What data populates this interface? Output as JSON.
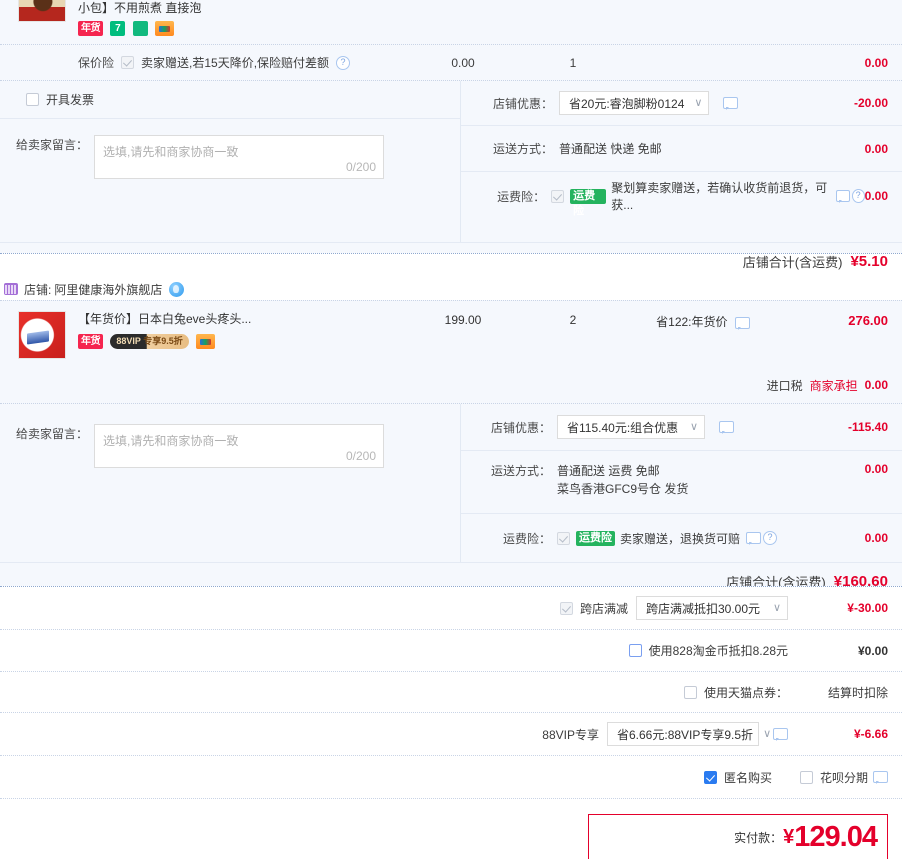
{
  "stores": [
    {
      "id": "store-1",
      "item": {
        "title_tail": "小包】不用煎煮 直接泡",
        "tags": [
          "年货",
          "7",
          "bag",
          "card"
        ]
      },
      "rows": [
        {
          "name": "price-guarantee",
          "label": "保价险",
          "checkbox": "checked-grey",
          "text": "卖家赠送,若15天降价,保险赔付差额",
          "qty": "1",
          "mid": "0.00",
          "amount": "0.00"
        }
      ],
      "invoice": {
        "label": "开具发票",
        "checkbox": "unchecked"
      },
      "message": {
        "label": "给卖家留言：",
        "placeholder": "选填,请先和商家协商一致",
        "counter": "0/200"
      },
      "options": [
        {
          "name": "shop-discount",
          "label": "店铺优惠：",
          "select": "省20元:睿泡脚粉0124",
          "has_bubble": true,
          "amount": "-20.00",
          "amount_bold": true
        },
        {
          "name": "shipping-method",
          "label": "运送方式：",
          "text": "普通配送 快递 免邮",
          "amount": "0.00"
        },
        {
          "name": "shipping-insurance",
          "label": "运费险：",
          "checkbox": "checked-grey",
          "badge": "运费险",
          "text": "聚划算卖家赠送，若确认收货前退货，可获...",
          "has_bubble": true,
          "has_qm": true,
          "amount": "0.00"
        }
      ],
      "subtotal": {
        "label": "店铺合计(含运费)",
        "value": "¥5.10"
      }
    },
    {
      "id": "store-2",
      "header": {
        "prefix": "店铺:",
        "name": "阿里健康海外旗舰店"
      },
      "item": {
        "title": "【年货价】日本白兔eve头疼头...",
        "tags": [
          "年货",
          "88vip",
          "card"
        ],
        "price": "199.00",
        "qty": "2",
        "promo": "省122:年货价",
        "sum": "276.00"
      },
      "tax": {
        "label": "进口税",
        "payer": "商家承担",
        "amount": "0.00"
      },
      "message": {
        "label": "给卖家留言：",
        "placeholder": "选填,请先和商家协商一致",
        "counter": "0/200"
      },
      "options": [
        {
          "name": "shop-discount",
          "label": "店铺优惠：",
          "select": "省115.40元:组合优惠",
          "has_bubble": true,
          "amount": "-115.40",
          "amount_bold": true
        },
        {
          "name": "shipping-method",
          "label": "运送方式：",
          "text": "普通配送 运费 免邮",
          "text2": "菜鸟香港GFC9号仓  发货",
          "amount": "0.00"
        },
        {
          "name": "shipping-insurance",
          "label": "运费险：",
          "checkbox": "checked-grey",
          "badge": "运费险",
          "text": "卖家赠送，退换货可赔",
          "has_bubble": true,
          "has_qm": true,
          "amount": "0.00"
        }
      ],
      "subtotal": {
        "label": "店铺合计(含运费)",
        "value": "¥160.60"
      }
    }
  ],
  "global_rows": [
    {
      "name": "cross-store-discount",
      "checkbox": "checked-grey",
      "label": "跨店满减",
      "select": "跨店满减抵扣30.00元",
      "amount": "¥-30.00",
      "amount_red": true
    },
    {
      "name": "tao-coin",
      "checkbox": "blue-unchecked",
      "label": "使用828淘金币抵扣8.28元",
      "amount": "¥0.00",
      "amount_red": false
    },
    {
      "name": "tmall-points",
      "checkbox": "unchecked",
      "label": "使用天猫点券：",
      "note": "结算时扣除"
    },
    {
      "name": "vip88-exclusive",
      "label": "88VIP专享",
      "select": "省6.66元:88VIP专享9.5折",
      "has_bubble": true,
      "amount": "¥-6.66",
      "amount_red": true
    }
  ],
  "footer_toggles": [
    {
      "name": "anonymous-purchase",
      "label": "匿名购买",
      "checkbox": "checked-blue"
    },
    {
      "name": "huabei-installment",
      "label": "花呗分期",
      "checkbox": "unchecked",
      "has_bubble": true
    }
  ],
  "total": {
    "label": "实付款：",
    "currency": "¥",
    "value": "129.04"
  }
}
